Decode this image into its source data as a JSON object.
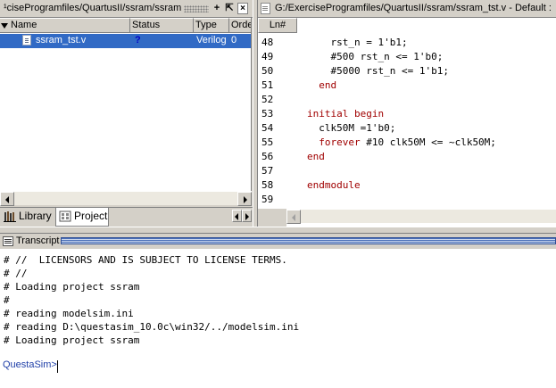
{
  "project_pane": {
    "title": "¹ciseProgramfiles/QuartusII/ssram/ssram",
    "buttons": {
      "add": "+",
      "undock": "⇱",
      "close": "×"
    },
    "columns": [
      "Name",
      "Status",
      "Type",
      "Orde"
    ],
    "files": [
      {
        "name": "ssram_tst.v",
        "status": "?",
        "type": "Verilog",
        "order": "0",
        "icon": "verilog-file-icon",
        "selected": true
      }
    ],
    "tabs": [
      {
        "label": "Library",
        "icon": "library-icon",
        "active": false
      },
      {
        "label": "Project",
        "icon": "project-icon",
        "active": true
      }
    ],
    "status_color": "#0000c8",
    "selection_color": "#316ac5"
  },
  "editor": {
    "title": "G:/ExerciseProgramfiles/QuartusII/ssram/ssram_tst.v - Default :",
    "ln_header": "Ln#",
    "keyword_color": "#a00000",
    "lines": [
      {
        "n": "48",
        "pre": "    ",
        "kw": "",
        "text": "rst_n = 1'b1;"
      },
      {
        "n": "49",
        "pre": "    ",
        "kw": "",
        "text": "#500 rst_n <= 1'b0;"
      },
      {
        "n": "50",
        "pre": "    ",
        "kw": "",
        "text": "#5000 rst_n <= 1'b1;"
      },
      {
        "n": "51",
        "pre": "  ",
        "kw": "end",
        "text": ""
      },
      {
        "n": "52",
        "pre": "",
        "kw": "",
        "text": ""
      },
      {
        "n": "53",
        "pre": "",
        "kw": "initial begin",
        "text": ""
      },
      {
        "n": "54",
        "pre": "  ",
        "kw": "",
        "text": "clk50M =1'b0;"
      },
      {
        "n": "55",
        "pre": "  ",
        "kw": "forever",
        "text": " #10 clk50M <= ~clk50M;"
      },
      {
        "n": "56",
        "pre": "",
        "kw": "end",
        "text": ""
      },
      {
        "n": "57",
        "pre": "",
        "kw": "",
        "text": ""
      },
      {
        "n": "58",
        "pre": "",
        "kw": "endmodule",
        "text": ""
      },
      {
        "n": "59",
        "pre": "",
        "kw": "",
        "text": ""
      }
    ]
  },
  "transcript": {
    "title": "Transcript",
    "lines": [
      "# //  LICENSORS AND IS SUBJECT TO LICENSE TERMS.",
      "# //",
      "# Loading project ssram",
      "#",
      "# reading modelsim.ini",
      "# reading D:\\questasim_10.0c\\win32/../modelsim.ini",
      "# Loading project ssram"
    ],
    "prompt": "QuestaSim>",
    "prompt_color": "#1f3fa8"
  }
}
